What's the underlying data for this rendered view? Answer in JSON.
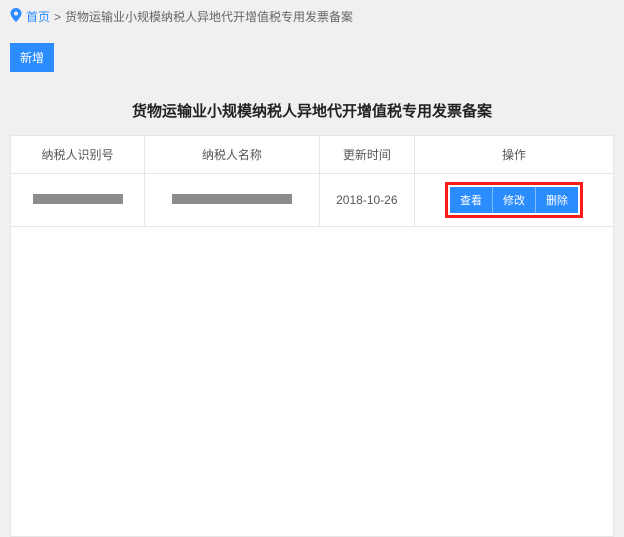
{
  "breadcrumb": {
    "home": "首页",
    "current": "货物运输业小规模纳税人异地代开增值税专用发票备案"
  },
  "buttons": {
    "new": "新增"
  },
  "page_title": "货物运输业小规模纳税人异地代开增值税专用发票备案",
  "table": {
    "headers": {
      "taxpayer_id": "纳税人识别号",
      "taxpayer_name": "纳税人名称",
      "update_time": "更新时间",
      "actions": "操作"
    },
    "row": {
      "update_time": "2018-10-26",
      "view": "查看",
      "edit": "修改",
      "delete": "删除"
    }
  }
}
